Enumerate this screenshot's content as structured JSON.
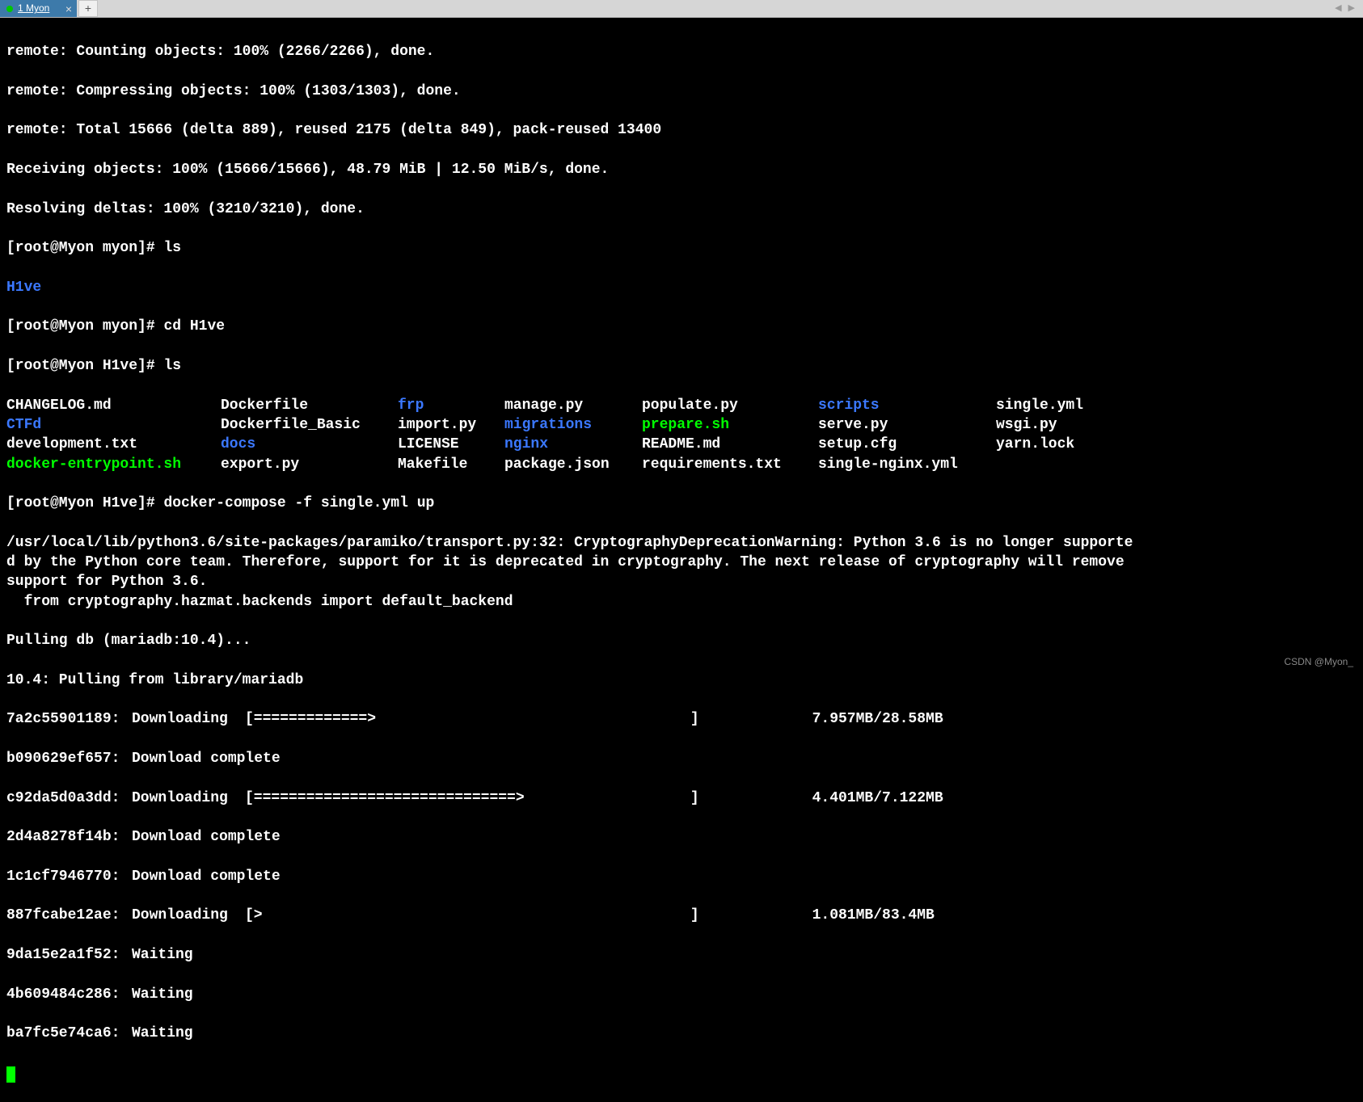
{
  "tabs": {
    "active": {
      "label": "1 Myon"
    }
  },
  "terminal": {
    "gitOutput": [
      "remote: Counting objects: 100% (2266/2266), done.",
      "remote: Compressing objects: 100% (1303/1303), done.",
      "remote: Total 15666 (delta 889), reused 2175 (delta 849), pack-reused 13400",
      "Receiving objects: 100% (15666/15666), 48.79 MiB | 12.50 MiB/s, done.",
      "Resolving deltas: 100% (3210/3210), done."
    ],
    "prompt1": "[root@Myon myon]# ",
    "cmd1": "ls",
    "ls1_out": "H1ve",
    "prompt2": "[root@Myon myon]# ",
    "cmd2": "cd H1ve",
    "prompt3": "[root@Myon H1ve]# ",
    "cmd3": "ls",
    "ls2": {
      "row1": {
        "c1": "CHANGELOG.md",
        "c2": "Dockerfile",
        "c3": "frp",
        "c4": "manage.py",
        "c5": "populate.py",
        "c6": "scripts",
        "c7": "single.yml"
      },
      "row2": {
        "c1": "CTFd",
        "c2": "Dockerfile_Basic",
        "c3": "import.py",
        "c4": "migrations",
        "c5": "prepare.sh",
        "c6": "serve.py",
        "c7": "wsgi.py"
      },
      "row3": {
        "c1": "development.txt",
        "c2": "docs",
        "c3": "LICENSE",
        "c4": "nginx",
        "c5": "README.md",
        "c6": "setup.cfg",
        "c7": "yarn.lock"
      },
      "row4": {
        "c1": "docker-entrypoint.sh",
        "c2": "export.py",
        "c3": "Makefile",
        "c4": "package.json",
        "c5": "requirements.txt",
        "c6": "single-nginx.yml",
        "c7": ""
      }
    },
    "prompt4": "[root@Myon H1ve]# ",
    "cmd4": "docker-compose -f single.yml up",
    "warning": "/usr/local/lib/python3.6/site-packages/paramiko/transport.py:32: CryptographyDeprecationWarning: Python 3.6 is no longer supporte\nd by the Python core team. Therefore, support for it is deprecated in cryptography. The next release of cryptography will remove \nsupport for Python 3.6.\n  from cryptography.hazmat.backends import default_backend",
    "pulling1": "Pulling db (mariadb:10.4)...",
    "pulling2": "10.4: Pulling from library/mariadb",
    "layers": [
      {
        "hash": "7a2c55901189:",
        "status": "Downloading",
        "bar": "[=============>                                    ]",
        "size": "  7.957MB/28.58MB"
      },
      {
        "hash": "b090629ef657:",
        "status": "Download complete",
        "bar": "",
        "size": ""
      },
      {
        "hash": "c92da5d0a3dd:",
        "status": "Downloading",
        "bar": "[==============================>                   ]",
        "size": "  4.401MB/7.122MB"
      },
      {
        "hash": "2d4a8278f14b:",
        "status": "Download complete",
        "bar": "",
        "size": ""
      },
      {
        "hash": "1c1cf7946770:",
        "status": "Download complete",
        "bar": "",
        "size": ""
      },
      {
        "hash": "887fcabe12ae:",
        "status": "Downloading",
        "bar": "[>                                                 ]",
        "size": "  1.081MB/83.4MB"
      },
      {
        "hash": "9da15e2a1f52:",
        "status": "Waiting",
        "bar": "",
        "size": ""
      },
      {
        "hash": "4b609484c286:",
        "status": "Waiting",
        "bar": "",
        "size": ""
      },
      {
        "hash": "ba7fc5e74ca6:",
        "status": "Waiting",
        "bar": "",
        "size": ""
      }
    ]
  },
  "watermark": "CSDN @Myon_"
}
